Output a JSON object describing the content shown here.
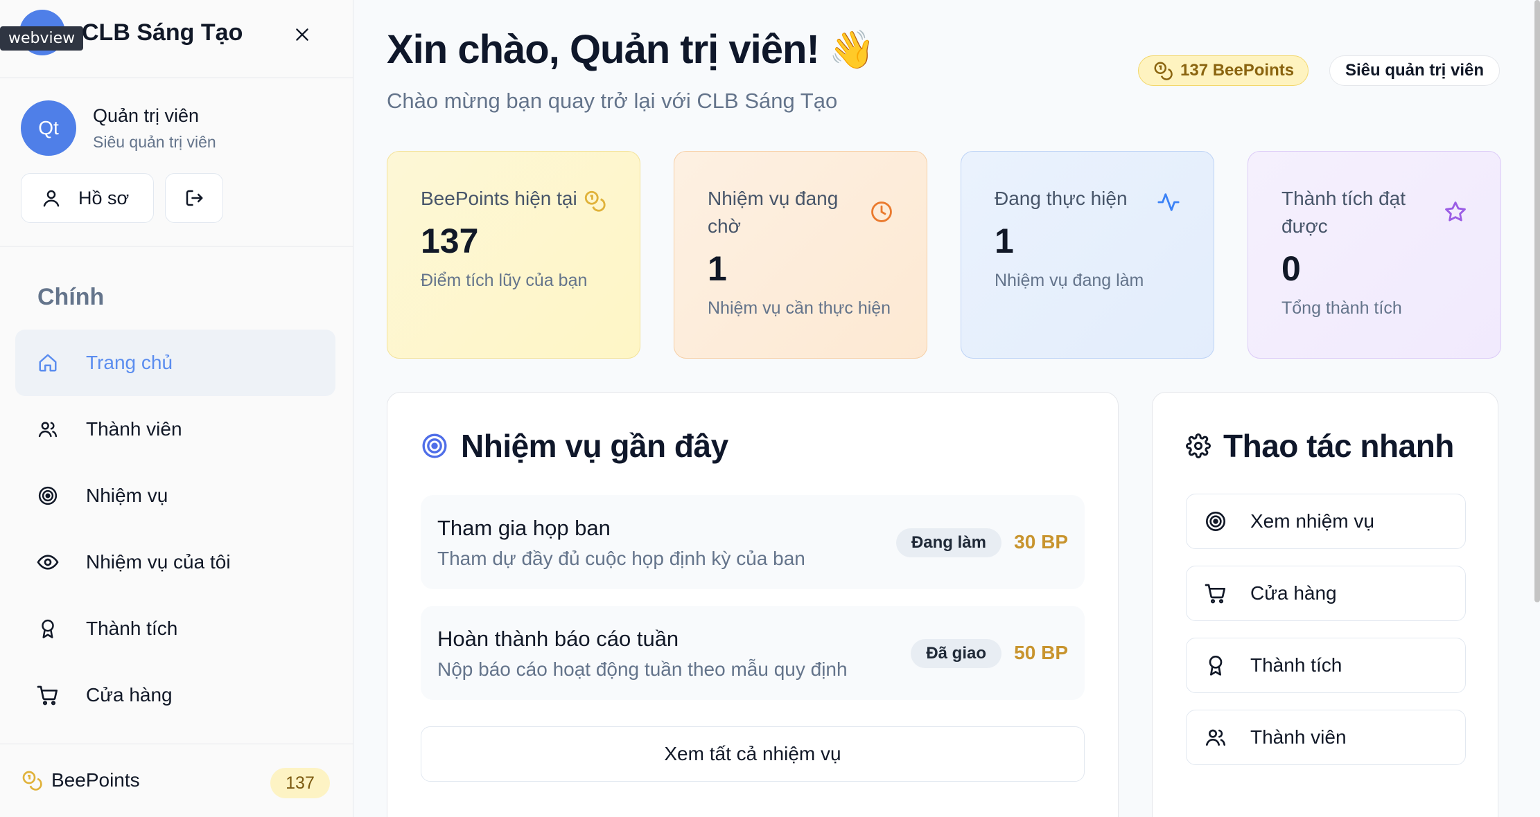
{
  "tooltip": "webview",
  "app": {
    "name": "CLB Sáng Tạo"
  },
  "user": {
    "initials": "Qt",
    "name": "Quản trị viên",
    "role": "Siêu quản trị viên",
    "profile_label": "Hồ sơ"
  },
  "sidebar": {
    "section": "Chính",
    "items": [
      {
        "label": "Trang chủ",
        "icon": "home-icon",
        "active": true
      },
      {
        "label": "Thành viên",
        "icon": "users-icon"
      },
      {
        "label": "Nhiệm vụ",
        "icon": "target-icon"
      },
      {
        "label": "Nhiệm vụ của tôi",
        "icon": "eye-icon"
      },
      {
        "label": "Thành tích",
        "icon": "award-icon"
      },
      {
        "label": "Cửa hàng",
        "icon": "cart-icon"
      }
    ],
    "footer": {
      "label": "BeePoints",
      "count": "137"
    }
  },
  "header": {
    "greeting": "Xin chào, Quản trị viên!",
    "emoji": "👋",
    "subtitle": "Chào mừng bạn quay trở lại với CLB Sáng Tạo",
    "points_pill": "137 BeePoints",
    "role_pill": "Siêu quản trị viên"
  },
  "stats": [
    {
      "label": "BeePoints hiện tại",
      "value": "137",
      "desc": "Điểm tích lũy của bạn",
      "icon": "coins-icon",
      "color": "#e0b23a"
    },
    {
      "label": "Nhiệm vụ đang chờ",
      "value": "1",
      "desc": "Nhiệm vụ cần thực hiện",
      "icon": "clock-icon",
      "color": "#ea7a2e"
    },
    {
      "label": "Đang thực hiện",
      "value": "1",
      "desc": "Nhiệm vụ đang làm",
      "icon": "activity-icon",
      "color": "#3b82f6"
    },
    {
      "label": "Thành tích đạt được",
      "value": "0",
      "desc": "Tổng thành tích",
      "icon": "star-icon",
      "color": "#9b5de5"
    }
  ],
  "recent_tasks": {
    "title": "Nhiệm vụ gần đây",
    "items": [
      {
        "title": "Tham gia họp ban",
        "desc": "Tham dự đầy đủ cuộc họp định kỳ của ban",
        "status": "Đang làm",
        "points": "30 BP"
      },
      {
        "title": "Hoàn thành báo cáo tuần",
        "desc": "Nộp báo cáo hoạt động tuần theo mẫu quy định",
        "status": "Đã giao",
        "points": "50 BP"
      }
    ],
    "see_all": "Xem tất cả nhiệm vụ"
  },
  "quick_actions": {
    "title": "Thao tác nhanh",
    "items": [
      {
        "label": "Xem nhiệm vụ",
        "icon": "target-icon"
      },
      {
        "label": "Cửa hàng",
        "icon": "cart-icon"
      },
      {
        "label": "Thành tích",
        "icon": "award-icon"
      },
      {
        "label": "Thành viên",
        "icon": "users-icon"
      }
    ]
  }
}
